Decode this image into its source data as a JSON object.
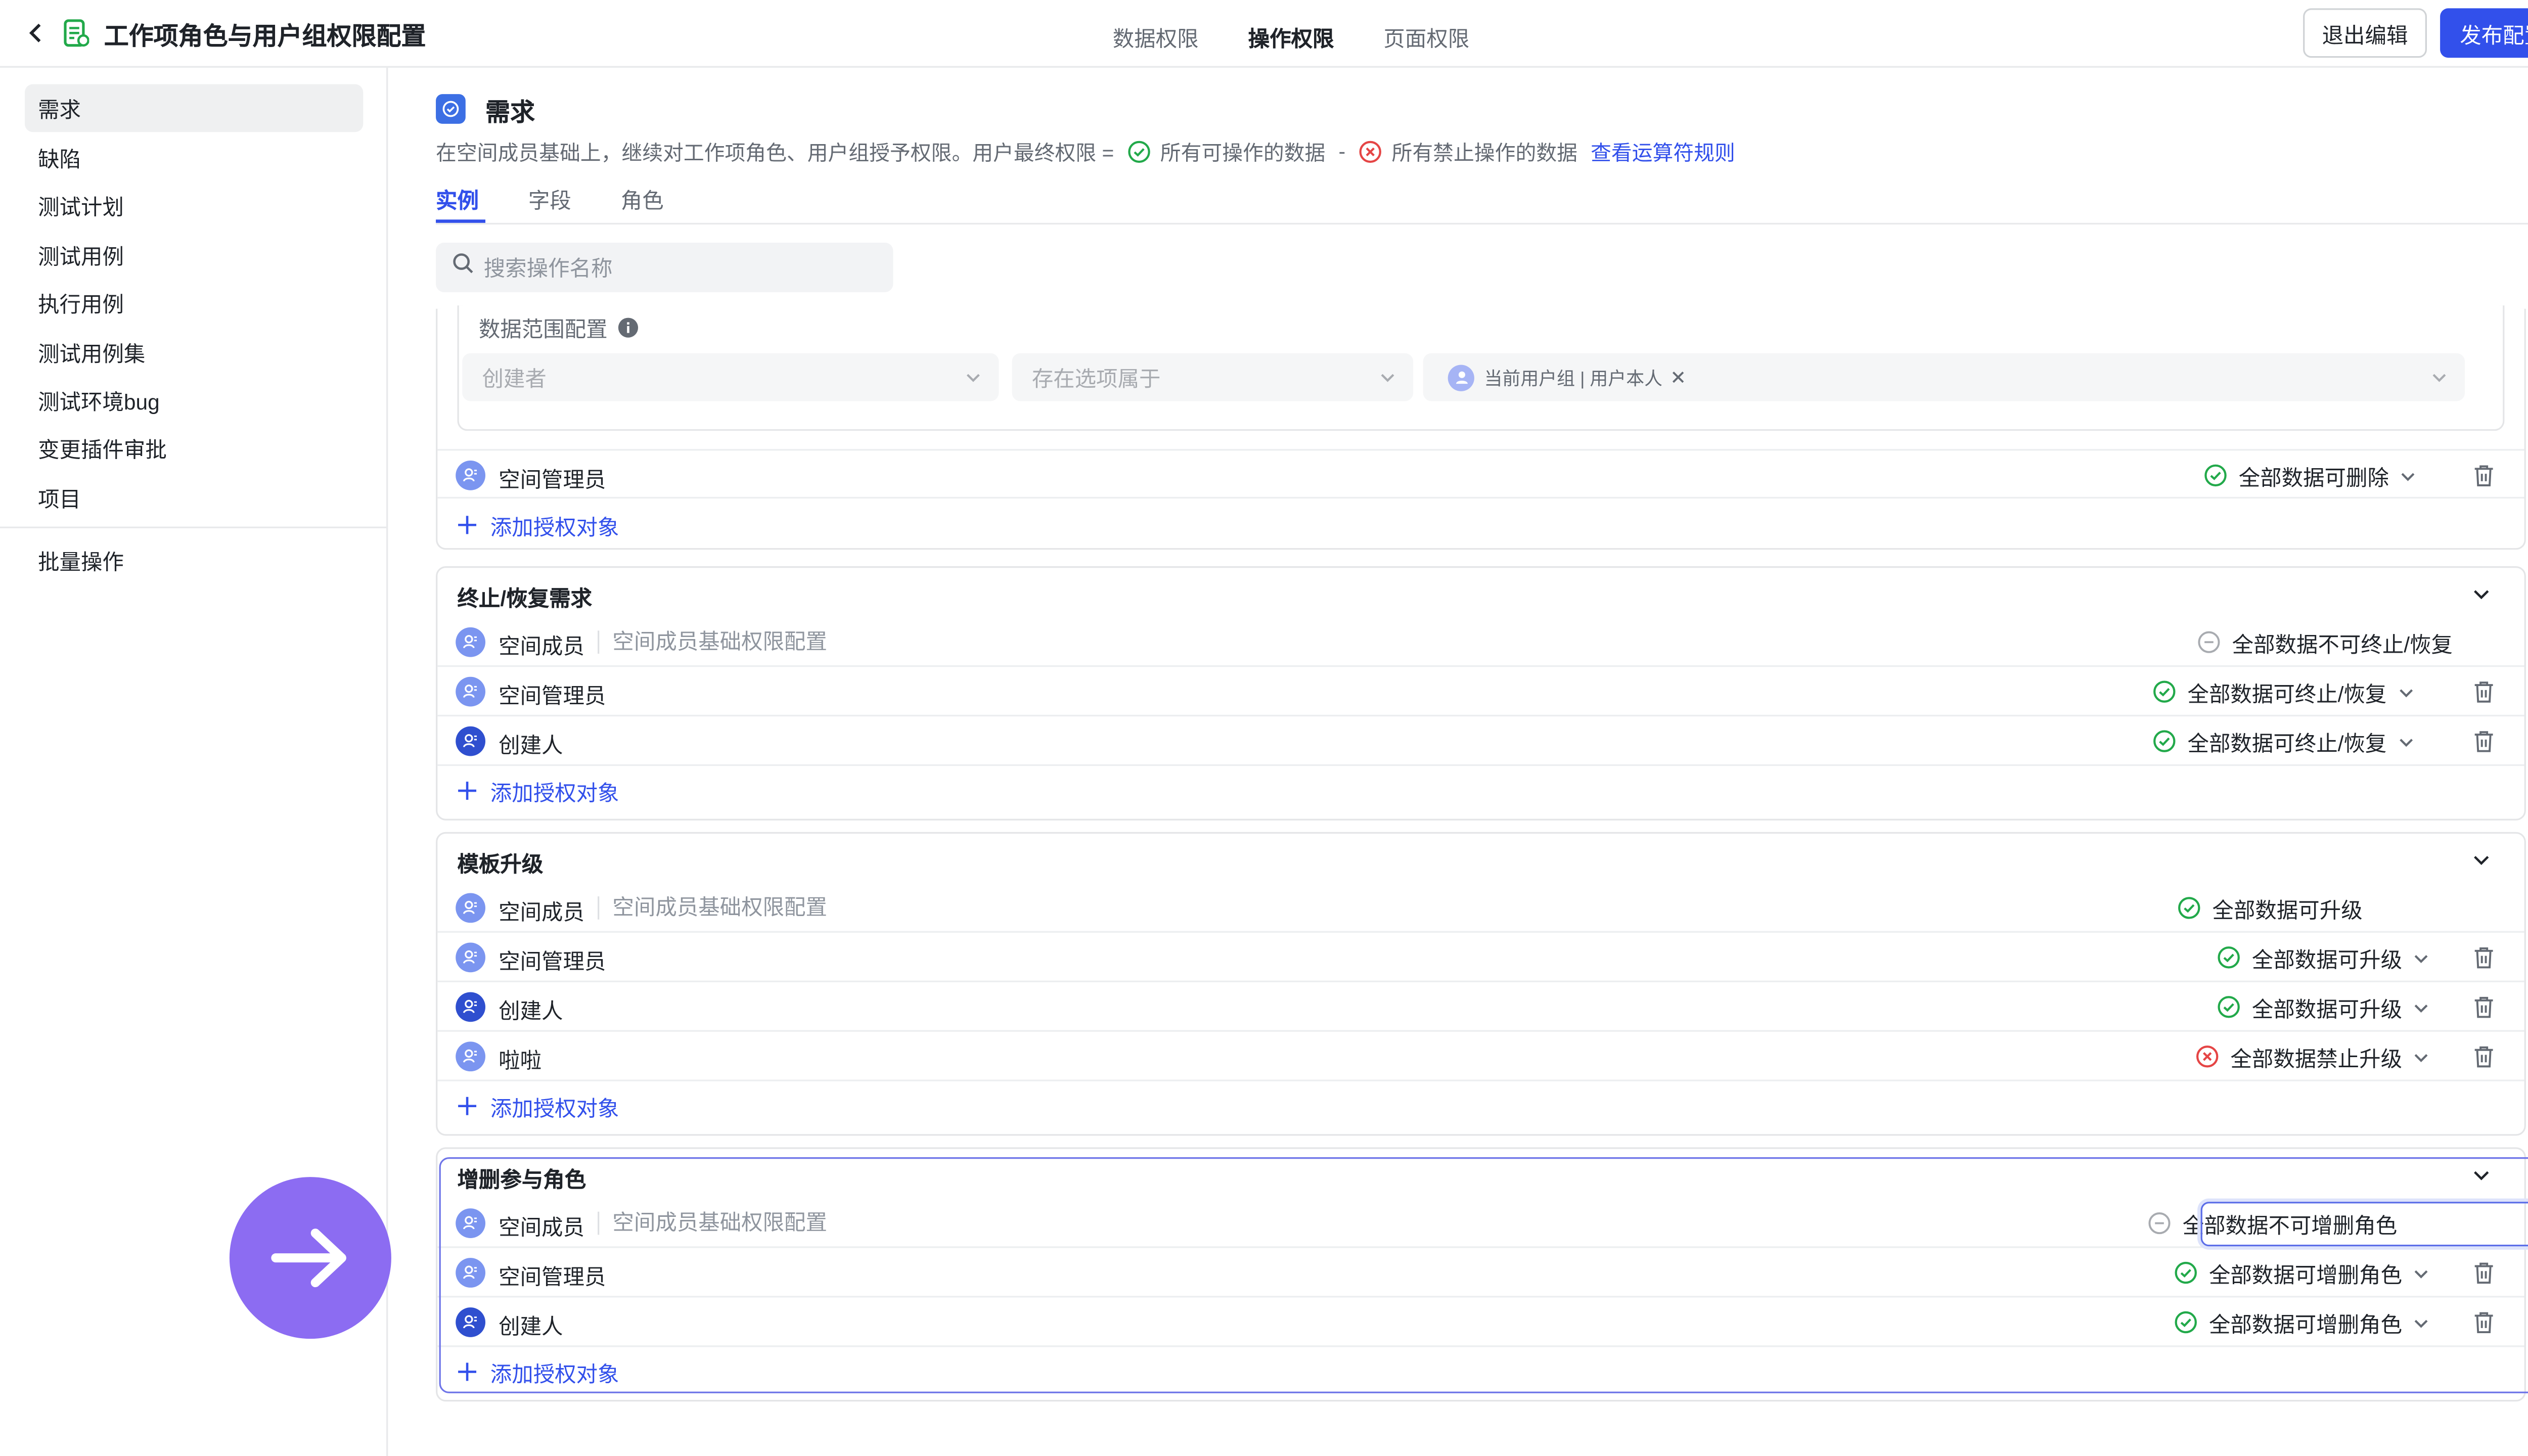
{
  "header": {
    "title": "工作项角色与用户组权限配置",
    "tabs": [
      "数据权限",
      "操作权限",
      "页面权限"
    ],
    "active_tab": "操作权限",
    "exit_label": "退出编辑",
    "publish_label": "发布配置"
  },
  "sidebar": {
    "items": [
      "需求",
      "缺陷",
      "测试计划",
      "测试用例",
      "执行用例",
      "测试用例集",
      "测试环境bug",
      "变更插件审批",
      "项目"
    ],
    "active": "需求",
    "batch_label": "批量操作"
  },
  "main": {
    "title": "需求",
    "desc_prefix": "在空间成员基础上，继续对工作项角色、用户组授予权限。用户最终权限 =",
    "desc_allowed": "所有可操作的数据",
    "desc_minus": "-",
    "desc_forbidden": "所有禁止操作的数据",
    "desc_link": "查看运算符规则",
    "sub_tabs": [
      "实例",
      "字段",
      "角色"
    ],
    "search_placeholder": "搜索操作名称",
    "add_label": "添加授权对象"
  },
  "scope": {
    "label": "数据范围配置",
    "select1": "创建者",
    "select2": "存在选项属于",
    "tag": "当前用户组 | 用户本人"
  },
  "first_card_row": {
    "name": "空间管理员",
    "perm": "全部数据可删除"
  },
  "cards": [
    {
      "title": "终止/恢复需求",
      "rows": [
        {
          "name": "空间成员",
          "note": "空间成员基础权限配置",
          "perm": "全部数据不可终止/恢复",
          "status": "neutral"
        },
        {
          "name": "空间管理员",
          "perm": "全部数据可终止/恢复",
          "status": "allow"
        },
        {
          "name": "创建人",
          "perm": "全部数据可终止/恢复",
          "status": "allow"
        }
      ]
    },
    {
      "title": "模板升级",
      "rows": [
        {
          "name": "空间成员",
          "note": "空间成员基础权限配置",
          "perm": "全部数据可升级",
          "status": "allow"
        },
        {
          "name": "空间管理员",
          "perm": "全部数据可升级",
          "status": "allow"
        },
        {
          "name": "创建人",
          "perm": "全部数据可升级",
          "status": "allow"
        },
        {
          "name": "啦啦",
          "perm": "全部数据禁止升级",
          "status": "deny"
        }
      ]
    },
    {
      "title": "增删参与角色",
      "rows": [
        {
          "name": "空间成员",
          "note": "空间成员基础权限配置",
          "perm": "全部数据不可增删角色",
          "status": "neutral"
        },
        {
          "name": "空间管理员",
          "perm": "全部数据可增删角色",
          "status": "allow"
        },
        {
          "name": "创建人",
          "perm": "全部数据可增删角色",
          "status": "allow"
        }
      ]
    }
  ],
  "colors": {
    "primary": "#3250eb",
    "allow": "#22a94a",
    "deny": "#e54545",
    "highlight": "#6f75e8",
    "fab": "#8c6cf2"
  }
}
